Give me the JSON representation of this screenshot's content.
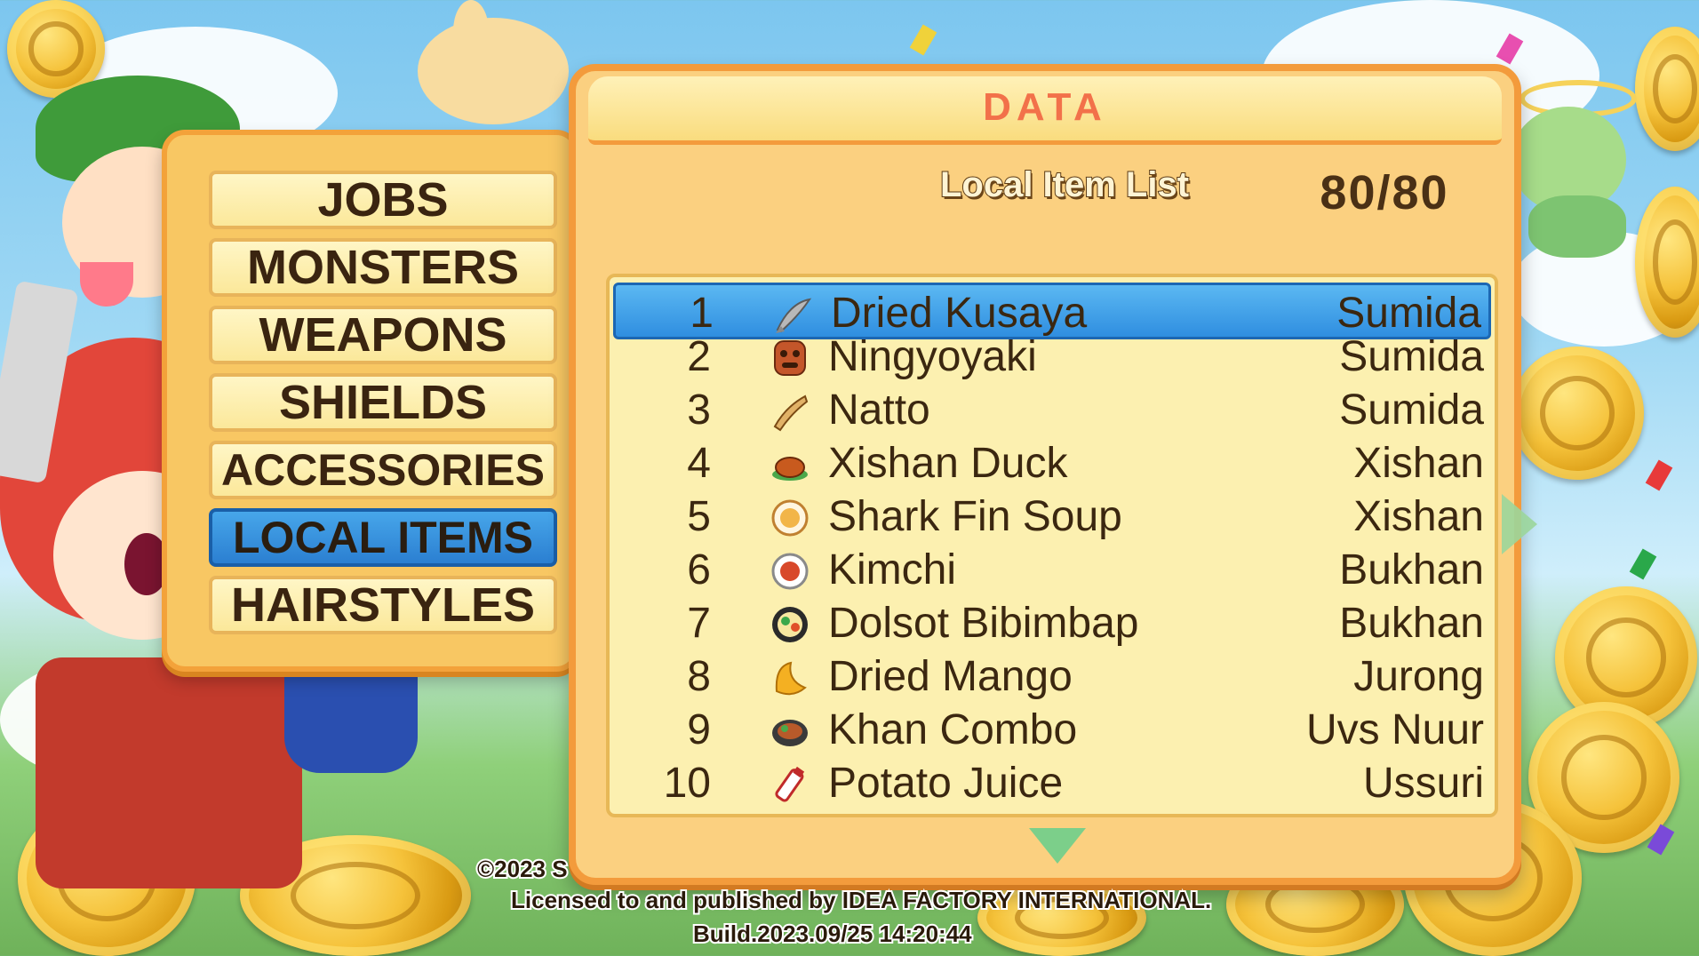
{
  "menu": {
    "items": [
      {
        "label": "JOBS",
        "active": false
      },
      {
        "label": "MONSTERS",
        "active": false
      },
      {
        "label": "WEAPONS",
        "active": false
      },
      {
        "label": "SHIELDS",
        "active": false
      },
      {
        "label": "ACCESSORIES",
        "active": false
      },
      {
        "label": "LOCAL ITEMS",
        "active": true
      },
      {
        "label": "HAIRSTYLES",
        "active": false
      }
    ]
  },
  "panel": {
    "title": "DATA",
    "list_heading": "Local Item List",
    "counter": "80/80",
    "rows": [
      {
        "num": "1",
        "icon": "dried-fish-icon",
        "name": "Dried Kusaya",
        "location": "Sumida",
        "selected": true
      },
      {
        "num": "2",
        "icon": "mask-icon",
        "name": "Ningyoyaki",
        "location": "Sumida",
        "selected": false
      },
      {
        "num": "3",
        "icon": "straw-pack-icon",
        "name": "Natto",
        "location": "Sumida",
        "selected": false
      },
      {
        "num": "4",
        "icon": "roast-duck-icon",
        "name": "Xishan Duck",
        "location": "Xishan",
        "selected": false
      },
      {
        "num": "5",
        "icon": "soup-bowl-icon",
        "name": "Shark Fin Soup",
        "location": "Xishan",
        "selected": false
      },
      {
        "num": "6",
        "icon": "kimchi-icon",
        "name": "Kimchi",
        "location": "Bukhan",
        "selected": false
      },
      {
        "num": "7",
        "icon": "bibimbap-icon",
        "name": "Dolsot Bibimbap",
        "location": "Bukhan",
        "selected": false
      },
      {
        "num": "8",
        "icon": "mango-icon",
        "name": "Dried Mango",
        "location": "Jurong",
        "selected": false
      },
      {
        "num": "9",
        "icon": "combo-plate-icon",
        "name": "Khan Combo",
        "location": "Uvs Nuur",
        "selected": false
      },
      {
        "num": "10",
        "icon": "juice-bottle-icon",
        "name": "Potato Juice",
        "location": "Ussuri",
        "selected": false
      }
    ]
  },
  "footer": {
    "copyright": "©2023 S",
    "license": "Licensed to and published by IDEA FACTORY INTERNATIONAL.",
    "build": "Build.2023.09/25 14:20:44"
  },
  "colors": {
    "panel_fill": "#fbd080",
    "panel_border": "#f39b3c",
    "selected_row": "#2f8ee0",
    "title_text": "#f2714a"
  }
}
